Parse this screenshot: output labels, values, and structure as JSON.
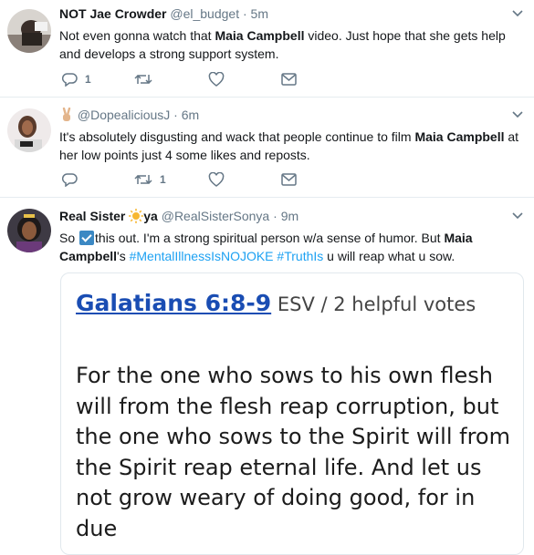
{
  "tweets": [
    {
      "name": "NOT Jae Crowder",
      "handle": "@el_budget",
      "dot": "·",
      "time": "5m",
      "text_parts": [
        "Not even gonna watch that ",
        "Maia Campbell",
        " video. Just hope that she gets help and develops a strong support system."
      ],
      "actions": {
        "reply_count": "1",
        "retweet_count": "",
        "like_count": ""
      }
    },
    {
      "name": "@DopealiciousJ",
      "dot": "·",
      "time": "6m",
      "text_parts": [
        "It's absolutely disgusting and wack that people continue to film ",
        "Maia Campbell",
        " at her low points just 4 some likes and reposts."
      ],
      "actions": {
        "reply_count": "",
        "retweet_count": "1",
        "like_count": ""
      }
    },
    {
      "name_before": "Real Sister ",
      "name_after": "ya",
      "handle": "@RealSisterSonya",
      "dot": "·",
      "time": "9m",
      "text_parts": [
        "So ",
        "this out. I'm a strong spiritual person w/a sense of humor. But ",
        "Maia Campbell",
        "'s ",
        "#MentalIllnessIsNOJOKE",
        " ",
        "#TruthIs",
        " u will reap what u sow."
      ],
      "card": {
        "reference": "Galatians 6:8-9",
        "meta": " ESV / 2 helpful votes",
        "verse": "For the one who sows to his own flesh will from the flesh reap corruption, but the one who sows to the Spirit will from the Spirit reap eternal life. And let us not grow weary of doing good, for in due"
      }
    }
  ],
  "icons": [
    "reply-icon",
    "retweet-icon",
    "like-icon",
    "message-icon",
    "caret-down-icon",
    "victory-hand-icon",
    "sun-icon",
    "check-mark-icon"
  ],
  "colors": {
    "text": "#14171a",
    "muted": "#657786",
    "link": "#1da1f2",
    "border": "#e6ecf0",
    "verse_link": "#1a4db3"
  }
}
